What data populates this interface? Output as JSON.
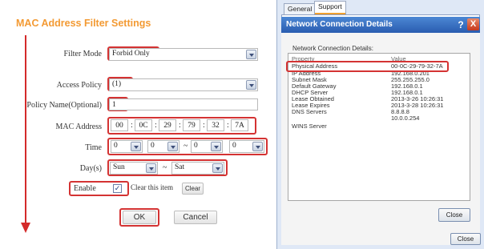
{
  "filter_page": {
    "title": "MAC Address Filter Settings",
    "labels": {
      "filter_mode": "Filter Mode",
      "access_policy": "Access Policy",
      "policy_name": "Policy Name(Optional)",
      "mac_address": "MAC Address",
      "time": "Time",
      "days": "Day(s)",
      "enable": "Enable",
      "clear_item": "Clear this item"
    },
    "filter_mode_value": "Forbid Only",
    "access_policy_value": "(1)",
    "policy_name_value": "1",
    "mac_octets": [
      "00",
      "0C",
      "29",
      "79",
      "32",
      "7A"
    ],
    "mac_sep": ":",
    "time_values": [
      "0",
      "0",
      "0",
      "0"
    ],
    "time_sep": "~",
    "day_from": "Sun",
    "day_to": "Sat",
    "day_sep": "~",
    "clear_button": "Clear",
    "ok_button": "OK",
    "cancel_button": "Cancel",
    "colors": {
      "title": "#f39a33",
      "highlight": "#d43333"
    }
  },
  "dialog": {
    "tabs": [
      "General",
      "Support"
    ],
    "title": "Network Connection Details",
    "help": "?",
    "close_glyph": "X",
    "details_label": "Network Connection Details:",
    "details_label_underline": "D",
    "header": {
      "property": "Property",
      "value": "Value"
    },
    "rows": [
      {
        "property": "Physical Address",
        "value": "00-0C-29-79-32-7A"
      },
      {
        "property": "IP Address",
        "value": "192.168.0.201"
      },
      {
        "property": "Subnet Mask",
        "value": "255.255.255.0"
      },
      {
        "property": "Default Gateway",
        "value": "192.168.0.1"
      },
      {
        "property": "DHCP Server",
        "value": "192.168.0.1"
      },
      {
        "property": "Lease Obtained",
        "value": "2013-3-26 10:26:31"
      },
      {
        "property": "Lease Expires",
        "value": "2013-3-28 10:26:31"
      },
      {
        "property": "DNS Servers",
        "value": "8.8.8.8"
      },
      {
        "property": "",
        "value": "10.0.0.254"
      },
      {
        "property": "WINS Server",
        "value": ""
      }
    ],
    "close_button": "Close",
    "close_button_outer": "Close"
  }
}
